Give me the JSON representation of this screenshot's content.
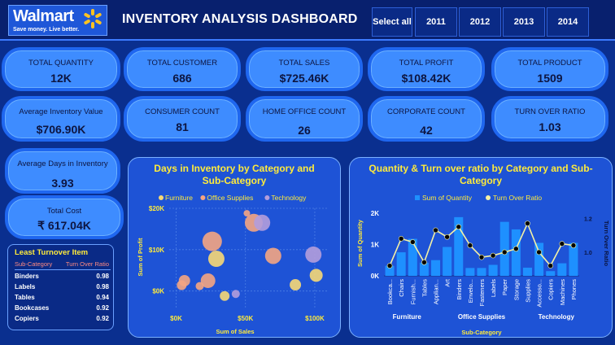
{
  "header": {
    "brand_name": "Walmart",
    "brand_tagline": "Save money. Live better.",
    "title": "INVENTORY ANALYSIS DASHBOARD",
    "filters": [
      {
        "label": "Select all"
      },
      {
        "label": "2011"
      },
      {
        "label": "2012"
      },
      {
        "label": "2013"
      },
      {
        "label": "2014"
      }
    ]
  },
  "kpis": {
    "total_quantity": {
      "label": "TOTAL QUANTITY",
      "value": "12K"
    },
    "total_customer": {
      "label": "TOTAL CUSTOMER",
      "value": "686"
    },
    "total_sales": {
      "label": "TOTAL SALES",
      "value": "$725.46K"
    },
    "total_profit": {
      "label": "TOTAL PROFIT",
      "value": "$108.42K"
    },
    "total_product": {
      "label": "TOTAL PRODUCT",
      "value": "1509"
    },
    "avg_inventory_value": {
      "label": "Average Inventory Value",
      "value": "$706.90K"
    },
    "consumer_count": {
      "label": "CONSUMER COUNT",
      "value": "81"
    },
    "home_office_count": {
      "label": "HOME OFFICE COUNT",
      "value": "26"
    },
    "corporate_count": {
      "label": "CORPORATE COUNT",
      "value": "42"
    },
    "turn_over_ratio": {
      "label": "TURN OVER RATIO",
      "value": "1.03"
    },
    "avg_days_inventory": {
      "label": "Average Days in Inventory",
      "value": "3.93"
    },
    "total_cost": {
      "label": "Total Cost",
      "value": "₹ 617.04K"
    }
  },
  "least_turnover": {
    "title": "Least Turnover Item",
    "col_subcat": "Sub-Category",
    "col_ratio": "Turn Over Ratio",
    "rows": [
      {
        "name": "Binders",
        "ratio": "0.98"
      },
      {
        "name": "Labels",
        "ratio": "0.98"
      },
      {
        "name": "Tables",
        "ratio": "0.94"
      },
      {
        "name": "Bookcases",
        "ratio": "0.92"
      },
      {
        "name": "Copiers",
        "ratio": "0.92"
      }
    ]
  },
  "colors": {
    "furniture": "#f6d875",
    "office_supplies": "#f4a582",
    "technology": "#b39ddb",
    "bar": "#1e90ff",
    "line": "#f4f1a5"
  },
  "chart_data": [
    {
      "type": "scatter",
      "title": "Days in Inventory by Category and Sub-Category",
      "xlabel": "Sum of Sales",
      "ylabel": "Sum of Profit",
      "xlim": [
        -5000,
        110000
      ],
      "ylim": [
        -4000,
        20000
      ],
      "xticks": [
        0,
        50000,
        100000
      ],
      "xtick_labels": [
        "$0K",
        "$50K",
        "$100K"
      ],
      "yticks": [
        0,
        10000,
        20000
      ],
      "ytick_labels": [
        "$0K",
        "$10K",
        "$20K"
      ],
      "grid": true,
      "legend_position": "top",
      "series": [
        {
          "name": "Furniture",
          "color_key": "furniture",
          "points": [
            {
              "x": 29000,
              "y": 7800,
              "r": 10
            },
            {
              "x": 86000,
              "y": 1500,
              "r": 7
            },
            {
              "x": 101000,
              "y": 3800,
              "r": 8
            },
            {
              "x": 35000,
              "y": -1200,
              "r": 6
            }
          ]
        },
        {
          "name": "Office Supplies",
          "color_key": "office_supplies",
          "points": [
            {
              "x": 26000,
              "y": 12000,
              "r": 12
            },
            {
              "x": 56000,
              "y": 16500,
              "r": 11
            },
            {
              "x": 70000,
              "y": 8500,
              "r": 10
            },
            {
              "x": 6000,
              "y": 2500,
              "r": 7
            },
            {
              "x": 4000,
              "y": 1400,
              "r": 6
            },
            {
              "x": 17000,
              "y": 1200,
              "r": 5
            },
            {
              "x": 23000,
              "y": 2500,
              "r": 9
            },
            {
              "x": 51000,
              "y": 18800,
              "r": 4
            }
          ]
        },
        {
          "name": "Technology",
          "color_key": "technology",
          "points": [
            {
              "x": 62000,
              "y": 16500,
              "r": 10
            },
            {
              "x": 99000,
              "y": 8800,
              "r": 10
            },
            {
              "x": 43000,
              "y": -700,
              "r": 5
            }
          ]
        }
      ]
    },
    {
      "type": "bar",
      "title": "Quantity & Turn over ratio by Category and Sub-Category",
      "xlabel": "Sub-Category",
      "ylabel": "Sum of Quantity",
      "y2label": "Turn Over Ratio",
      "ylim": [
        0,
        2100
      ],
      "yticks": [
        0,
        1000,
        2000
      ],
      "ytick_labels": [
        "0K",
        "1K",
        "2K"
      ],
      "y2lim": [
        0.86,
        1.25
      ],
      "y2ticks": [
        1.0,
        1.2
      ],
      "y2tick_labels": [
        "1.0",
        "1.2"
      ],
      "legend_position": "top",
      "categories": [
        "Bookca...",
        "Chairs",
        "Furnish...",
        "Tables",
        "Applian...",
        "Art",
        "Binders",
        "Envelo...",
        "Fasteners",
        "Labels",
        "Paper",
        "Storage",
        "Supplies",
        "Accesso...",
        "Copiers",
        "Machines",
        "Phones"
      ],
      "groups": [
        {
          "name": "Furniture",
          "count": 4
        },
        {
          "name": "Office Supplies",
          "count": 9
        },
        {
          "name": "Technology",
          "count": 4
        }
      ],
      "series": [
        {
          "name": "Sum of Quantity",
          "kind": "bar",
          "values": [
            320,
            750,
            1180,
            420,
            500,
            920,
            1870,
            250,
            250,
            350,
            1720,
            1480,
            260,
            1050,
            150,
            400,
            1050
          ]
        },
        {
          "name": "Turn Over Ratio",
          "kind": "line",
          "values": [
            0.92,
            1.08,
            1.06,
            0.94,
            1.13,
            1.09,
            1.15,
            1.04,
            0.97,
            0.98,
            1.0,
            1.02,
            1.17,
            1.0,
            0.92,
            1.05,
            1.04
          ]
        }
      ]
    }
  ]
}
